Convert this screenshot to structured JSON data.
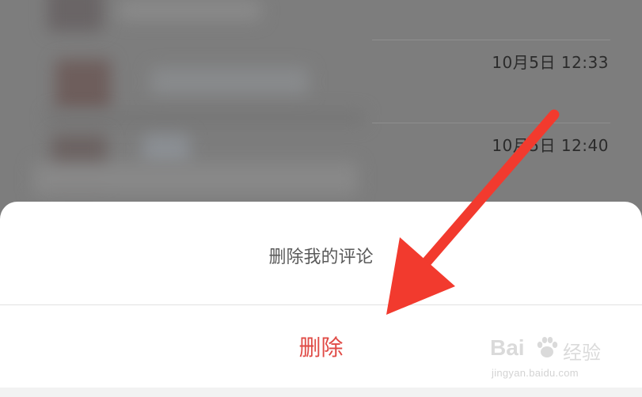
{
  "comments": [
    {
      "timestamp": "10月5日 12:33"
    },
    {
      "timestamp": "10月5日 12:40"
    }
  ],
  "action_sheet": {
    "title": "删除我的评论",
    "delete_label": "删除"
  },
  "watermark": {
    "brand": "Bai",
    "brand_cn": "经验",
    "url": "jingyan.baidu.com"
  },
  "colors": {
    "overlay": "#7d7d7d",
    "delete_red": "#e04b46",
    "arrow_red": "#f23a2e"
  }
}
